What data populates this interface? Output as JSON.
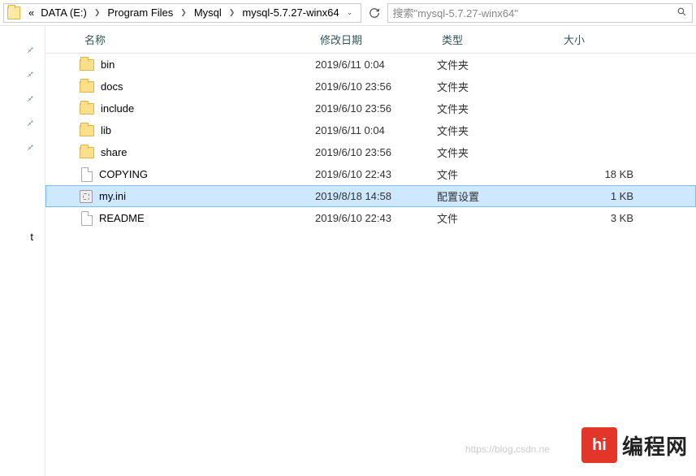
{
  "breadcrumbs": {
    "prefix": "«",
    "items": [
      "DATA (E:)",
      "Program Files",
      "Mysql",
      "mysql-5.7.27-winx64"
    ]
  },
  "search": {
    "placeholder": "搜索\"mysql-5.7.27-winx64\""
  },
  "columns": {
    "name": "名称",
    "date": "修改日期",
    "type": "类型",
    "size": "大小"
  },
  "rows": [
    {
      "icon": "folder",
      "name": "bin",
      "date": "2019/6/11 0:04",
      "type": "文件夹",
      "size": "",
      "selected": false
    },
    {
      "icon": "folder",
      "name": "docs",
      "date": "2019/6/10 23:56",
      "type": "文件夹",
      "size": "",
      "selected": false
    },
    {
      "icon": "folder",
      "name": "include",
      "date": "2019/6/10 23:56",
      "type": "文件夹",
      "size": "",
      "selected": false
    },
    {
      "icon": "folder",
      "name": "lib",
      "date": "2019/6/11 0:04",
      "type": "文件夹",
      "size": "",
      "selected": false
    },
    {
      "icon": "folder",
      "name": "share",
      "date": "2019/6/10 23:56",
      "type": "文件夹",
      "size": "",
      "selected": false
    },
    {
      "icon": "file",
      "name": "COPYING",
      "date": "2019/6/10 22:43",
      "type": "文件",
      "size": "18 KB",
      "selected": false
    },
    {
      "icon": "ini",
      "name": "my.ini",
      "date": "2019/8/18 14:58",
      "type": "配置设置",
      "size": "1 KB",
      "selected": true
    },
    {
      "icon": "file",
      "name": "README",
      "date": "2019/6/10 22:43",
      "type": "文件",
      "size": "3 KB",
      "selected": false
    }
  ],
  "watermark": {
    "logo_text": "hi",
    "brand": "编程网",
    "url": "https://blog.csdn.ne"
  }
}
